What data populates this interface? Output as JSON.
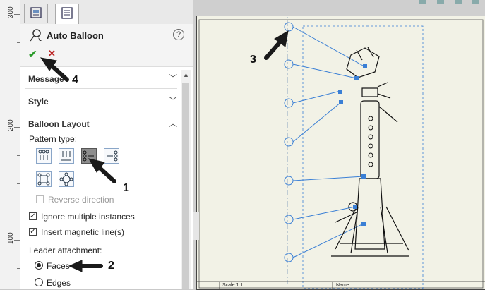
{
  "ruler": {
    "labels": [
      "300",
      "200",
      "100"
    ]
  },
  "property_manager": {
    "title": "Auto Balloon",
    "sections": [
      {
        "label": "Message"
      },
      {
        "label": "Style"
      },
      {
        "label": "Balloon Layout"
      }
    ],
    "pattern_type_label": "Pattern type:",
    "reverse_direction": "Reverse direction",
    "ignore_multiple": "Ignore multiple instances",
    "insert_magnetic": "Insert magnetic line(s)",
    "leader_attachment_label": "Leader attachment:",
    "faces": "Faces",
    "edges": "Edges"
  },
  "callouts": {
    "c1": "1",
    "c2": "2",
    "c3": "3",
    "c4": "4"
  },
  "title_block": {
    "scale": "Scale:1:1",
    "name": "Name:"
  },
  "colors": {
    "accent_blue": "#3a7fd5",
    "ok_green": "#2a9b2a",
    "cancel_red": "#b22222"
  }
}
